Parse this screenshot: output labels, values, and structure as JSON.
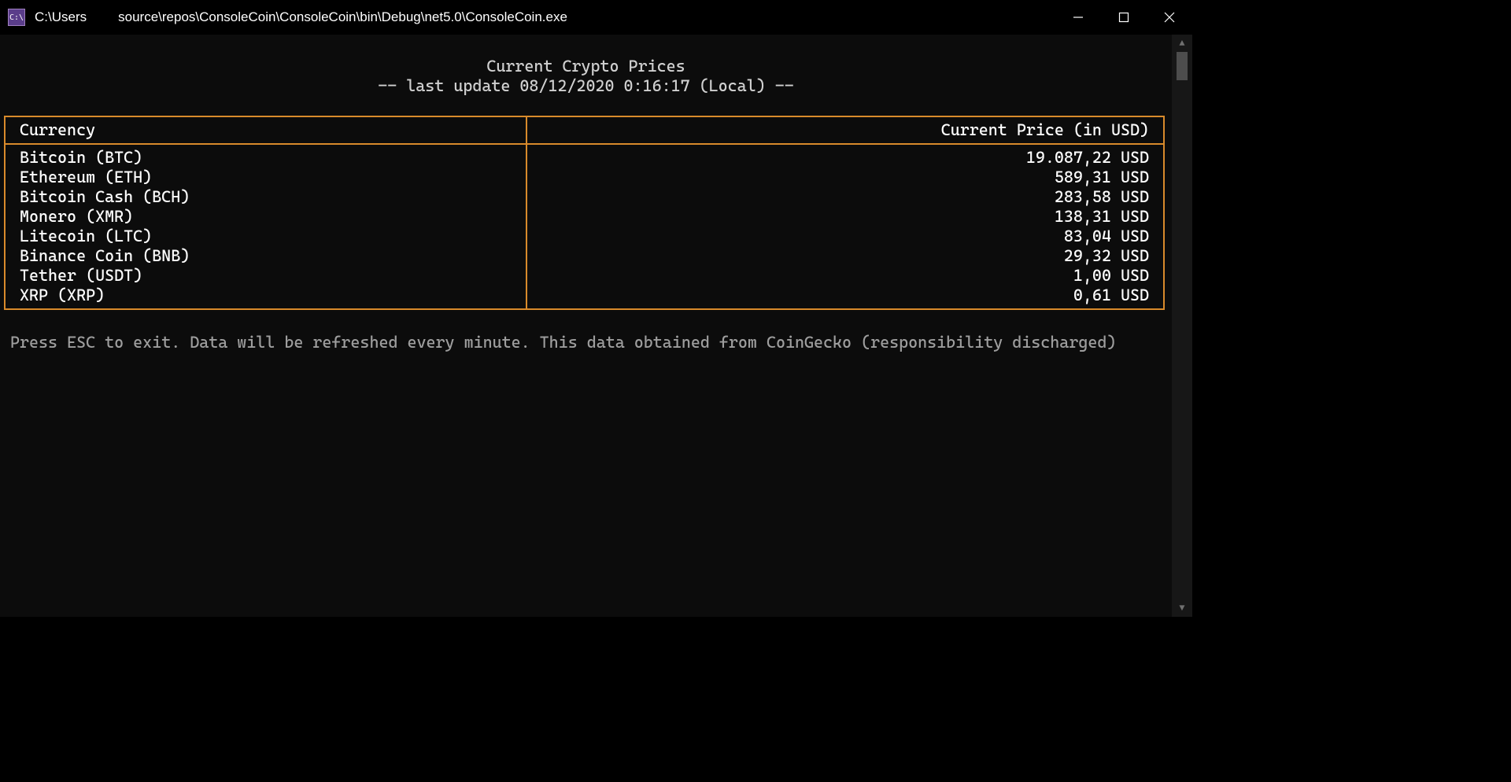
{
  "window": {
    "title_left": "C:\\Users",
    "title_path": "source\\repos\\ConsoleCoin\\ConsoleCoin\\bin\\Debug\\net5.0\\ConsoleCoin.exe",
    "icon_label": "C:\\"
  },
  "header": {
    "title": "Current Crypto Prices",
    "subtitle": "-- last update 08/12/2020 0:16:17 (Local) --"
  },
  "table": {
    "col_currency": "Currency",
    "col_price": "Current Price (in USD)",
    "rows": [
      {
        "currency": "Bitcoin (BTC)",
        "price": "19.087,22 USD"
      },
      {
        "currency": "Ethereum (ETH)",
        "price": "589,31 USD"
      },
      {
        "currency": "Bitcoin Cash (BCH)",
        "price": "283,58 USD"
      },
      {
        "currency": "Monero (XMR)",
        "price": "138,31 USD"
      },
      {
        "currency": "Litecoin (LTC)",
        "price": "83,04 USD"
      },
      {
        "currency": "Binance Coin (BNB)",
        "price": "29,32 USD"
      },
      {
        "currency": "Tether (USDT)",
        "price": "1,00 USD"
      },
      {
        "currency": "XRP (XRP)",
        "price": "0,61 USD"
      }
    ]
  },
  "footer": "Press ESC to exit. Data will be refreshed every minute. This data obtained from CoinGecko (responsibility discharged)",
  "chart_data": {
    "type": "table",
    "title": "Current Crypto Prices",
    "columns": [
      "Currency",
      "Current Price (in USD)"
    ],
    "rows": [
      [
        "Bitcoin (BTC)",
        19087.22
      ],
      [
        "Ethereum (ETH)",
        589.31
      ],
      [
        "Bitcoin Cash (BCH)",
        283.58
      ],
      [
        "Monero (XMR)",
        138.31
      ],
      [
        "Litecoin (LTC)",
        83.04
      ],
      [
        "Binance Coin (BNB)",
        29.32
      ],
      [
        "Tether (USDT)",
        1.0
      ],
      [
        "XRP (XRP)",
        0.61
      ]
    ],
    "currency": "USD",
    "timestamp_local": "08/12/2020 0:16:17"
  }
}
